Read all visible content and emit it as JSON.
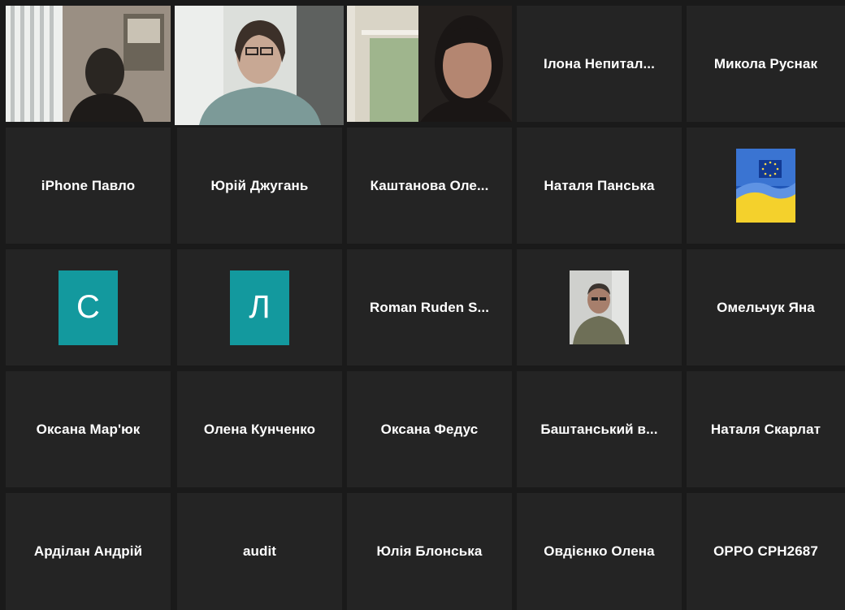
{
  "colors": {
    "background": "#1a1a1a",
    "tile": "#242424",
    "active_speaker_border": "#c9e26b",
    "initial_tile": "#13999e",
    "label": "#ffffff"
  },
  "participants": [
    {
      "label": "",
      "kind": "video"
    },
    {
      "label": "",
      "kind": "video",
      "active_speaker": true
    },
    {
      "label": "",
      "kind": "video"
    },
    {
      "label": "Ілона  Непитал...",
      "kind": "name"
    },
    {
      "label": "Микола Руснак",
      "kind": "name"
    },
    {
      "label": "iPhone Павло",
      "kind": "name"
    },
    {
      "label": "Юрій Джугань",
      "kind": "name"
    },
    {
      "label": "Каштанова  Оле...",
      "kind": "name"
    },
    {
      "label": "Наталя Панська",
      "kind": "name"
    },
    {
      "label": "",
      "kind": "avatar",
      "avatar": "eu-ukraine-flag"
    },
    {
      "label": "",
      "kind": "initial",
      "initial": "С"
    },
    {
      "label": "",
      "kind": "initial",
      "initial": "Л"
    },
    {
      "label": "Roman  Ruden  S...",
      "kind": "name"
    },
    {
      "label": "",
      "kind": "avatar",
      "avatar": "man-photo"
    },
    {
      "label": "Омельчук Яна",
      "kind": "name"
    },
    {
      "label": "Оксана Мар'юк",
      "kind": "name"
    },
    {
      "label": "Олена Кунченко",
      "kind": "name"
    },
    {
      "label": "Оксана Федус",
      "kind": "name"
    },
    {
      "label": "Баштанський  в...",
      "kind": "name"
    },
    {
      "label": "Наталя Скарлат",
      "kind": "name"
    },
    {
      "label": "Арділан Андрій",
      "kind": "name"
    },
    {
      "label": "audit",
      "kind": "name"
    },
    {
      "label": "Юлія Блонська",
      "kind": "name"
    },
    {
      "label": "Овдієнко Олена",
      "kind": "name"
    },
    {
      "label": "OPPO CPH2687",
      "kind": "name"
    }
  ]
}
